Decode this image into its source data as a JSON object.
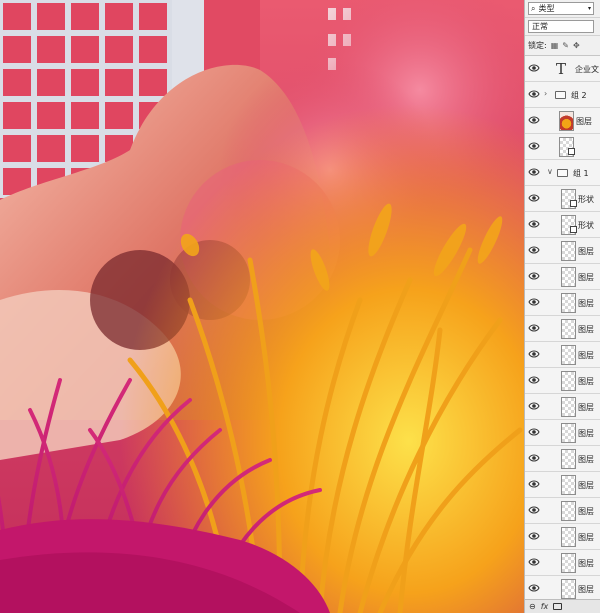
{
  "layers_panel": {
    "filter_label": "类型",
    "blend_mode": "正常",
    "lock_label": "锁定:",
    "layers": [
      {
        "kind": "text",
        "name": "企业文"
      },
      {
        "kind": "group",
        "name": "组 2"
      },
      {
        "kind": "image",
        "name": "图层"
      },
      {
        "kind": "shape-linked",
        "name": ""
      },
      {
        "kind": "group-open",
        "name": "组 1"
      },
      {
        "kind": "shape",
        "name": "形状"
      },
      {
        "kind": "shape",
        "name": "形状"
      },
      {
        "kind": "pixel",
        "name": "图层"
      },
      {
        "kind": "pixel",
        "name": "图层"
      },
      {
        "kind": "pixel",
        "name": "图层"
      },
      {
        "kind": "pixel",
        "name": "图层"
      },
      {
        "kind": "pixel",
        "name": "图层"
      },
      {
        "kind": "pixel",
        "name": "图层"
      },
      {
        "kind": "pixel",
        "name": "图层"
      },
      {
        "kind": "pixel",
        "name": "图层"
      },
      {
        "kind": "pixel",
        "name": "图层"
      },
      {
        "kind": "pixel",
        "name": "图层"
      },
      {
        "kind": "pixel",
        "name": "图层"
      },
      {
        "kind": "pixel",
        "name": "图层"
      },
      {
        "kind": "pixel",
        "name": "图层"
      },
      {
        "kind": "pixel",
        "name": "图层"
      },
      {
        "kind": "pixel",
        "name": "图层"
      }
    ],
    "bottom_icons": [
      "link-icon",
      "fx-icon",
      "mask-icon"
    ],
    "fx_label": "fx"
  },
  "colors": {
    "canvas_top": "#e8546d",
    "grass_yellow": "#f2a516",
    "grass_magenta": "#c2166b",
    "panel_bg": "#f0f0f0"
  }
}
